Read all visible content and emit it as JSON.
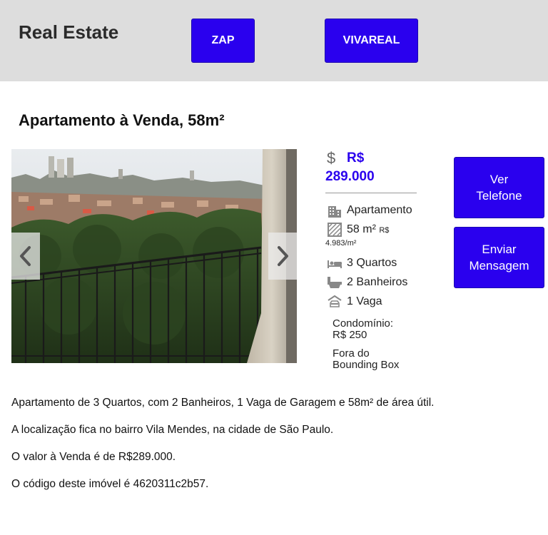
{
  "header": {
    "brand": "Real Estate",
    "nav": [
      {
        "label": "ZAP"
      },
      {
        "label": "VIVAREAL"
      }
    ]
  },
  "listing": {
    "title": "Apartamento à Venda, 58m²",
    "price_currency": "R$",
    "price_value": "289.000",
    "type": "Apartamento",
    "area": "58 m²",
    "price_per_m2_currency": "R$",
    "price_per_m2": "4.983/m²",
    "bedrooms": "3 Quartos",
    "bathrooms": "2 Banheiros",
    "parking": "1 Vaga",
    "condo_label": "Condomínio:",
    "condo_value": "R$ 250",
    "out_of_bounds_line1": "Fora do",
    "out_of_bounds_line2": "Bounding Box"
  },
  "actions": {
    "phone_line1": "Ver",
    "phone_line2": "Telefone",
    "message_line1": "Enviar",
    "message_line2": "Mensagem"
  },
  "description": {
    "p1": "Apartamento de 3 Quartos, com 2 Banheiros, 1 Vaga de Garagem e 58m² de área útil.",
    "p2": "A localização fica no bairro Vila Mendes, na cidade de São Paulo.",
    "p3": "O valor à Venda é de R$289.000.",
    "p4": "O código deste imóvel é 4620311c2b57."
  },
  "colors": {
    "accent": "#2a00ee",
    "header_bg": "#dddddd"
  },
  "icons": [
    "dollar-icon",
    "building-icon",
    "area-icon",
    "bed-icon",
    "bathtub-icon",
    "car-icon",
    "chevron-left-icon",
    "chevron-right-icon"
  ]
}
